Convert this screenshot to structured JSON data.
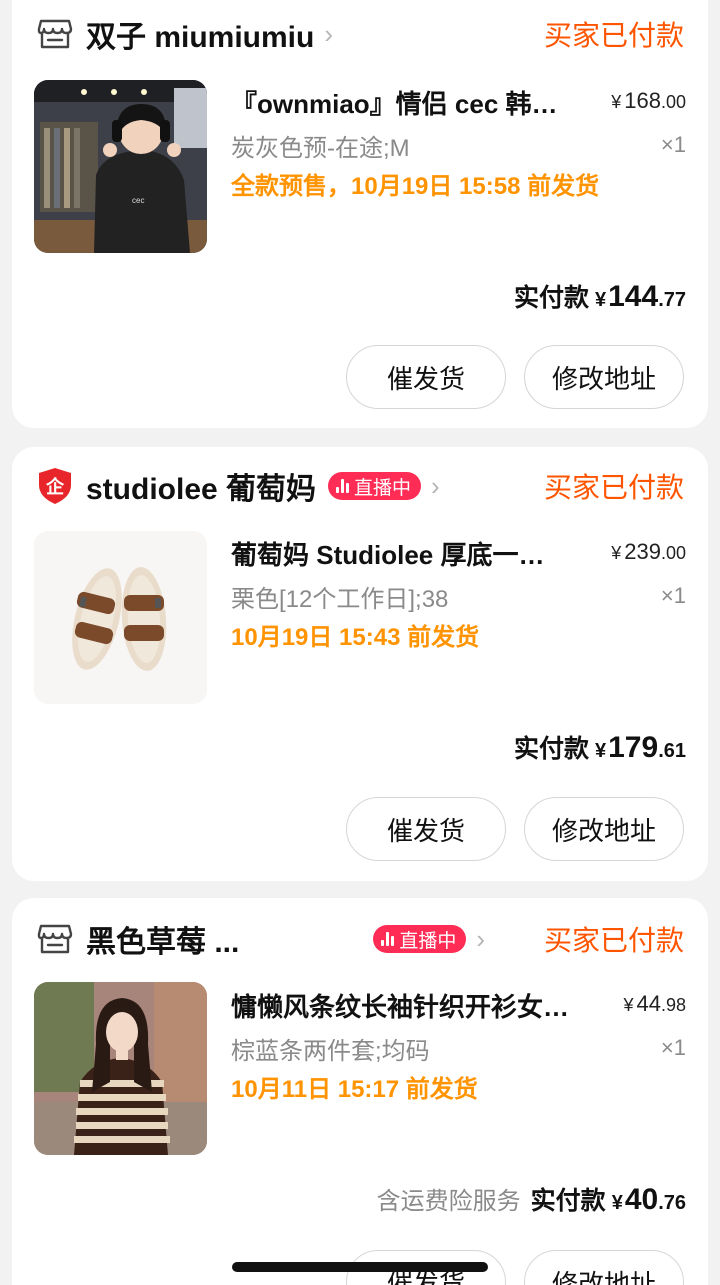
{
  "orders": [
    {
      "shop_name": "双子 miumiumiu",
      "shop_icon": "store-icon",
      "live": false,
      "status": "买家已付款",
      "product_title": "『ownmiao』情侣 cec 韩…",
      "price_int": "168",
      "price_dec": ".00",
      "sku": "炭灰色预-在途;M",
      "qty": "×1",
      "ship_info": "全款预售，10月19日 15:58 前发货",
      "insurance": "",
      "paid_label": "实付款",
      "paid_int": "144",
      "paid_dec": ".77",
      "btn_urge": "催发货",
      "btn_address": "修改地址"
    },
    {
      "shop_name": "studiolee 葡萄妈",
      "shop_icon": "enterprise-shield-icon",
      "live": true,
      "live_label": "直播中",
      "status": "买家已付款",
      "product_title": "葡萄妈 Studiolee 厚底一…",
      "price_int": "239",
      "price_dec": ".00",
      "sku": "栗色[12个工作日];38",
      "qty": "×1",
      "ship_info": "10月19日 15:43 前发货",
      "insurance": "",
      "paid_label": "实付款",
      "paid_int": "179",
      "paid_dec": ".61",
      "btn_urge": "催发货",
      "btn_address": "修改地址"
    },
    {
      "shop_name": "黑色草莓 ...",
      "shop_icon": "store-icon",
      "live": true,
      "live_label": "直播中",
      "status": "买家已付款",
      "product_title": "慵懒风条纹长袖针织开衫女…",
      "price_int": "44",
      "price_dec": ".98",
      "sku": "棕蓝条两件套;均码",
      "qty": "×1",
      "ship_info": "10月11日 15:17 前发货",
      "insurance": "含运费险服务",
      "paid_label": "实付款",
      "paid_int": "40",
      "paid_dec": ".76",
      "btn_urge": "催发货",
      "btn_address": "修改地址"
    }
  ],
  "currency": "¥",
  "colors": {
    "status": "#ff5500",
    "ship": "#ff9300",
    "live_badge": "#ff2d55",
    "background": "#f2f2f2"
  }
}
